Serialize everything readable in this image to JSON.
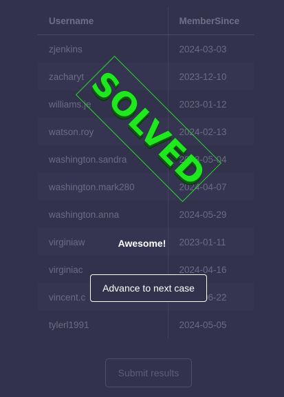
{
  "table": {
    "headers": [
      "Username",
      "MemberSince"
    ],
    "rows": [
      {
        "username": "zjenkins",
        "member_since": "2024-03-03"
      },
      {
        "username": "zacharyt",
        "member_since": "2023-12-10"
      },
      {
        "username": "williams.je",
        "member_since": "2023-01-12"
      },
      {
        "username": "watson.roy",
        "member_since": "2024-02-13"
      },
      {
        "username": "washington.sandra",
        "member_since": "2023-05-04"
      },
      {
        "username": "washington.mark280",
        "member_since": "2024-04-07"
      },
      {
        "username": "washington.anna",
        "member_since": "2024-05-29"
      },
      {
        "username": "virginiaw",
        "member_since": "2023-01-11"
      },
      {
        "username": "virginiac",
        "member_since": "2024-04-16"
      },
      {
        "username": "vincent.c",
        "member_since": "2024-06-22"
      },
      {
        "username": "tylerl1991",
        "member_since": "2024-05-05"
      }
    ]
  },
  "submit_label": "Submit results",
  "stamp_text": "SOLVED",
  "success_message": "Awesome!",
  "advance_label": "Advance to next case",
  "colors": {
    "background": "#32324d",
    "stamp_green": "#1fe81f",
    "text_white": "#ffffff"
  }
}
